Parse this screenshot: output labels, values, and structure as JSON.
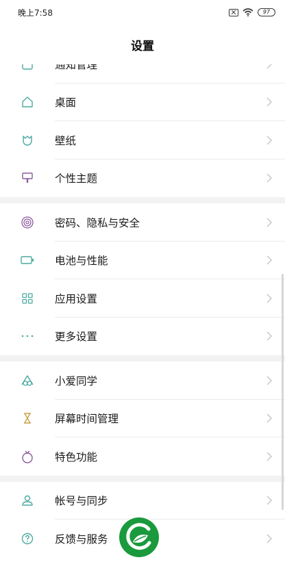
{
  "status_bar": {
    "time": "晚上7:58",
    "battery": "97"
  },
  "header": {
    "title": "设置"
  },
  "groups": [
    {
      "items": [
        {
          "label": "通知管理",
          "icon": "notification-icon"
        },
        {
          "label": "桌面",
          "icon": "home-icon"
        },
        {
          "label": "壁纸",
          "icon": "wallpaper-flower-icon"
        },
        {
          "label": "个性主题",
          "icon": "theme-brush-icon"
        }
      ]
    },
    {
      "items": [
        {
          "label": "密码、隐私与安全",
          "icon": "fingerprint-icon"
        },
        {
          "label": "电池与性能",
          "icon": "battery-icon"
        },
        {
          "label": "应用设置",
          "icon": "apps-grid-icon"
        },
        {
          "label": "更多设置",
          "icon": "more-dots-icon"
        }
      ]
    },
    {
      "items": [
        {
          "label": "小爱同学",
          "icon": "xiaoai-icon"
        },
        {
          "label": "屏幕时间管理",
          "icon": "hourglass-icon"
        },
        {
          "label": "特色功能",
          "icon": "special-features-icon"
        }
      ]
    },
    {
      "items": [
        {
          "label": "帐号与同步",
          "icon": "account-icon"
        },
        {
          "label": "反馈与服务",
          "icon": "help-icon"
        }
      ]
    }
  ],
  "colors": {
    "icon_teal": "#4aa9a0",
    "icon_purple": "#8a5a9e",
    "icon_gold": "#c9a04a",
    "logo_green": "#1a9a3c"
  }
}
